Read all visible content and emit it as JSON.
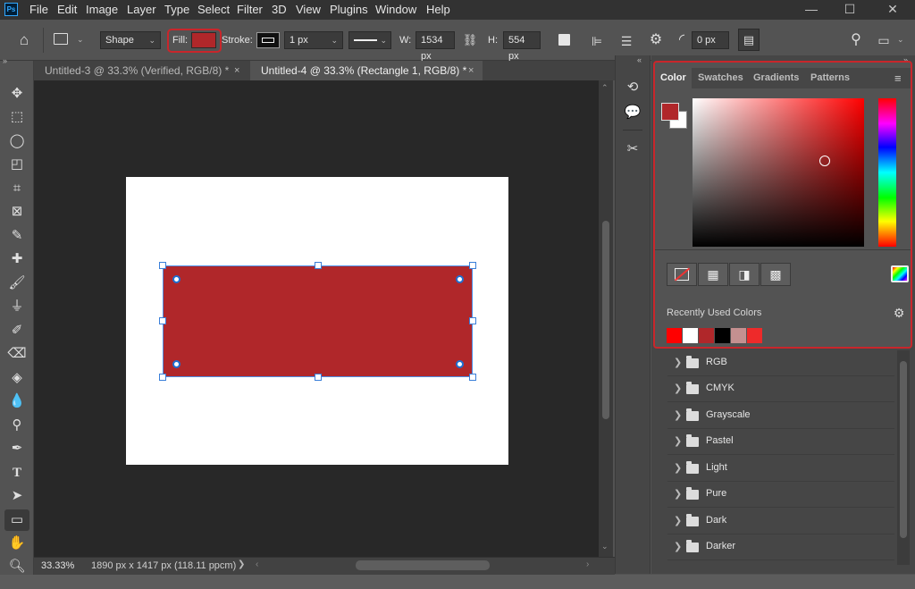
{
  "app": {
    "logo": "Ps",
    "menu": [
      "File",
      "Edit",
      "Image",
      "Layer",
      "Type",
      "Select",
      "Filter",
      "3D",
      "View",
      "Plugins",
      "Window",
      "Help"
    ],
    "window_controls": {
      "minimize": "—",
      "maximize": "☐",
      "close": "✕"
    }
  },
  "options": {
    "mode": "Shape",
    "fill_label": "Fill:",
    "fill_color": "#b0272a",
    "stroke_label": "Stroke:",
    "stroke_width": "1 px",
    "w_label": "W:",
    "w_value": "1534 px",
    "h_label": "H:",
    "h_value": "554 px",
    "radius_value": "0 px"
  },
  "tabs": [
    {
      "label": "Untitled-3 @ 33.3% (Verified, RGB/8) *",
      "close": "×",
      "active": false
    },
    {
      "label": "Untitled-4 @ 33.3% (Rectangle 1, RGB/8) *",
      "close": "×",
      "active": true
    }
  ],
  "document": {
    "background": "#ffffff",
    "shape_color": "#b0272a"
  },
  "status": {
    "zoom": "33.33%",
    "doc_info": "1890 px x 1417 px (118.11 ppcm)",
    "arrow": "❯"
  },
  "color_panel": {
    "tabs": [
      "Color",
      "Swatches",
      "Gradients",
      "Patterns"
    ],
    "active_tab": "Color",
    "foreground": "#b0272a",
    "background": "#ffffff",
    "recent_label": "Recently Used Colors",
    "recent_colors": [
      "#ff0000",
      "#ffffff",
      "#b0272a",
      "#000000",
      "#c49090",
      "#ee2a2a"
    ]
  },
  "swatch_groups": [
    "RGB",
    "CMYK",
    "Grayscale",
    "Pastel",
    "Light",
    "Pure",
    "Dark",
    "Darker"
  ],
  "colors": {
    "highlight": "#c9262b",
    "selection": "#4d8fe6"
  }
}
